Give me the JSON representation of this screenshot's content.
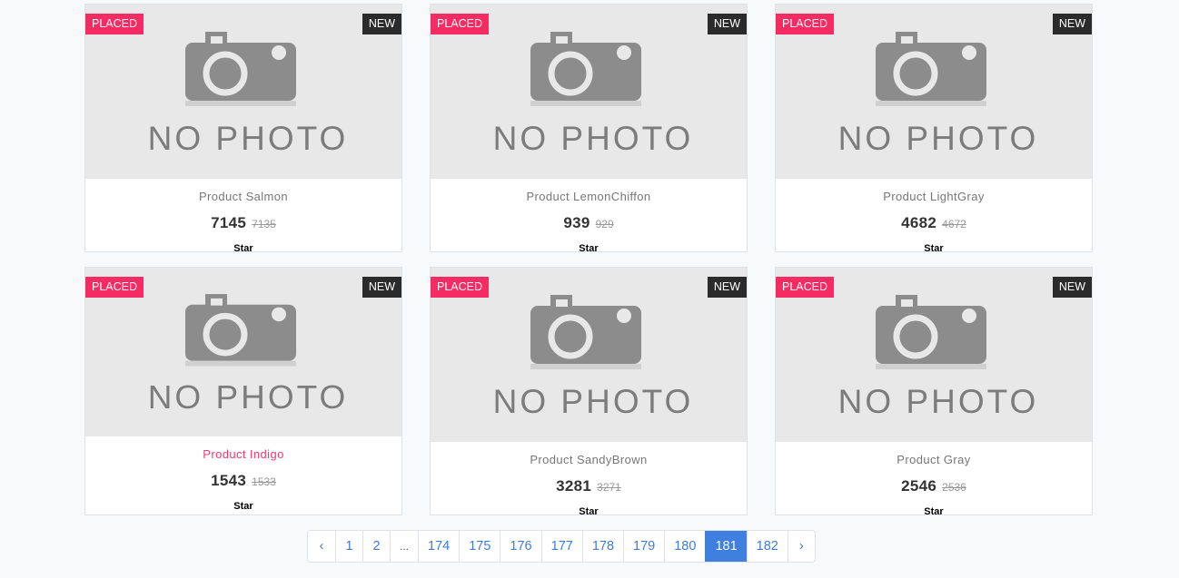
{
  "products": [
    {
      "badge_left": "PLACED",
      "badge_right": "NEW",
      "photo_text": "NO PHOTO",
      "name": "Product Salmon",
      "price": "7145",
      "old_price": "7135",
      "star": "Star",
      "name_active": false
    },
    {
      "badge_left": "PLACED",
      "badge_right": "NEW",
      "photo_text": "NO PHOTO",
      "name": "Product LemonChiffon",
      "price": "939",
      "old_price": "929",
      "star": "Star",
      "name_active": false
    },
    {
      "badge_left": "PLACED",
      "badge_right": "NEW",
      "photo_text": "NO PHOTO",
      "name": "Product LightGray",
      "price": "4682",
      "old_price": "4672",
      "star": "Star",
      "name_active": false
    },
    {
      "badge_left": "PLACED",
      "badge_right": "NEW",
      "photo_text": "NO PHOTO",
      "name": "Product Indigo",
      "price": "1543",
      "old_price": "1533",
      "star": "Star",
      "name_active": true
    },
    {
      "badge_left": "PLACED",
      "badge_right": "NEW",
      "photo_text": "NO PHOTO",
      "name": "Product SandyBrown",
      "price": "3281",
      "old_price": "3271",
      "star": "Star",
      "name_active": false
    },
    {
      "badge_left": "PLACED",
      "badge_right": "NEW",
      "photo_text": "NO PHOTO",
      "name": "Product Gray",
      "price": "2546",
      "old_price": "2536",
      "star": "Star",
      "name_active": false
    }
  ],
  "pagination": {
    "prev": "‹",
    "pages": [
      "1",
      "2",
      "...",
      "174",
      "175",
      "176",
      "177",
      "178",
      "179",
      "180",
      "181",
      "182"
    ],
    "active": "181",
    "next": "›"
  },
  "colors": {
    "placed_badge": "#f52c63",
    "new_badge": "#2b2b2b",
    "accent": "#3f7fe0",
    "active_title": "#e83e74"
  }
}
